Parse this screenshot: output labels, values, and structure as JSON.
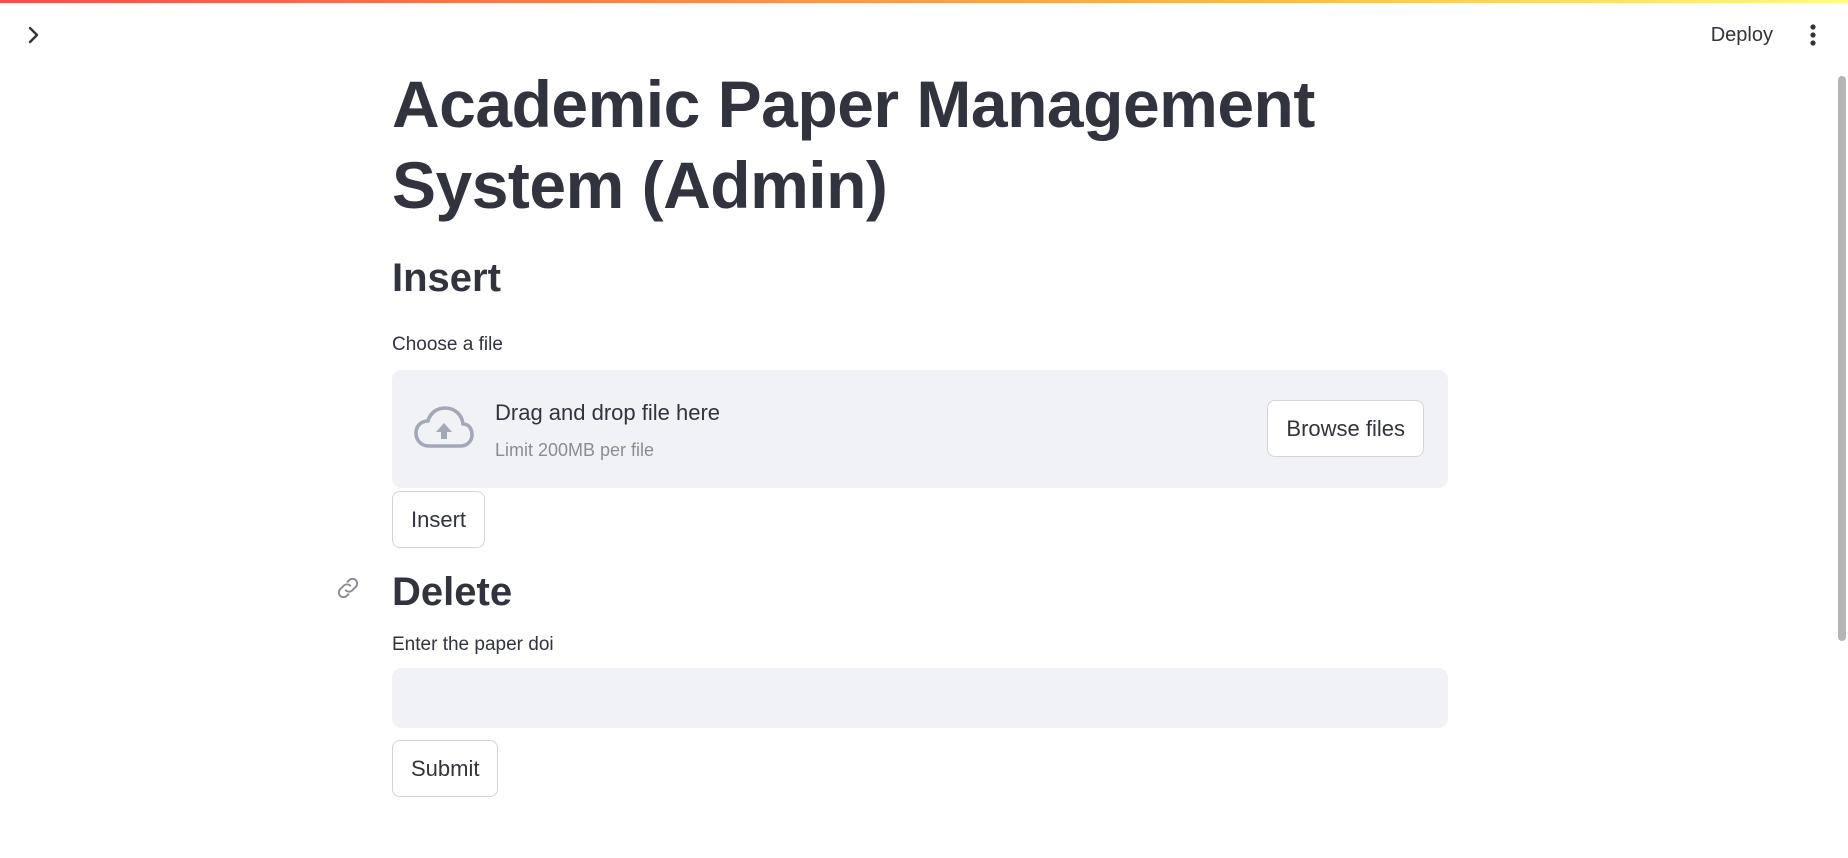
{
  "app": {
    "title": "Academic Paper Management System (Admin)",
    "toolbar": {
      "deploy_label": "Deploy"
    }
  },
  "sections": {
    "insert": {
      "heading": "Insert",
      "file_label": "Choose a file",
      "dropzone": {
        "title": "Drag and drop file here",
        "limit": "Limit 200MB per file",
        "browse_label": "Browse files"
      },
      "button_label": "Insert"
    },
    "delete": {
      "heading": "Delete",
      "doi_label": "Enter the paper doi",
      "doi_value": "",
      "doi_placeholder": "",
      "button_label": "Submit"
    }
  },
  "colors": {
    "accent_gradient_start": "#ff4b4b",
    "accent_gradient_end": "#fffd80",
    "text": "#31333f",
    "surface": "#f0f2f6"
  },
  "icons": [
    "chevron-right-icon",
    "more-vertical-icon",
    "cloud-upload-icon",
    "link-icon"
  ]
}
